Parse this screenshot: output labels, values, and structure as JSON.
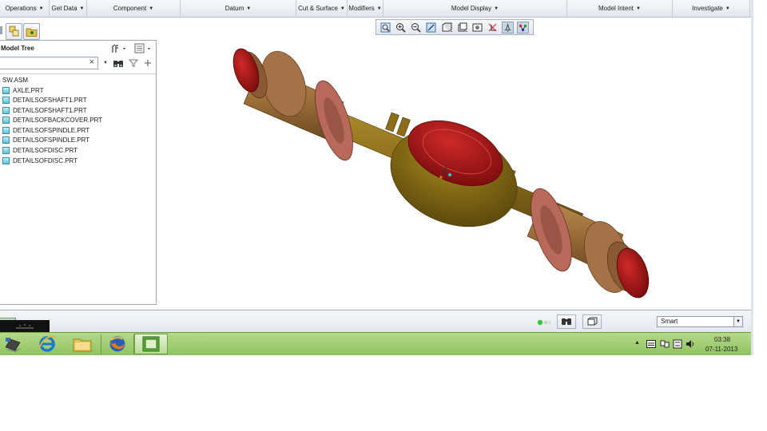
{
  "ribbon": {
    "menus": [
      {
        "label": "Operations"
      },
      {
        "label": "Get Data"
      },
      {
        "label": "Component"
      },
      {
        "label": "Datum"
      },
      {
        "label": "Cut & Surface"
      },
      {
        "label": "Modifiers"
      },
      {
        "label": "Model Display"
      },
      {
        "label": "Model Intent"
      },
      {
        "label": "Investigate"
      }
    ]
  },
  "model_tree": {
    "title": "Model Tree",
    "search_value": "",
    "clear_symbol": "×",
    "root": "SW.ASM",
    "items": [
      {
        "label": "AXLE.PRT"
      },
      {
        "label": "DETAILSOFSHAFT1.PRT"
      },
      {
        "label": "DETAILSOFSHAFT1.PRT"
      },
      {
        "label": "DETAILSOFBACKCOVER.PRT"
      },
      {
        "label": "DETAILSOFSPINDLE.PRT"
      },
      {
        "label": "DETAILSOFSPINDLE.PRT"
      },
      {
        "label": "DETAILSOFDISC.PRT"
      },
      {
        "label": "DETAILSOFDISC.PRT"
      }
    ]
  },
  "viewport_toolbar": {
    "icons": [
      "zoom-fit-icon",
      "zoom-in-icon",
      "zoom-out-icon",
      "repaint-icon",
      "display-style-icon",
      "saved-views-icon",
      "view-manager-icon",
      "datum-display-icon",
      "annotation-display-icon",
      "spin-center-icon"
    ]
  },
  "status_bar": {
    "filter_value": "Smart"
  },
  "taskbar": {
    "time": "03:38",
    "date": "07-11-2013"
  },
  "colors": {
    "axle_body": "#8a6a22",
    "flange": "#b56a5a",
    "hub_red": "#a81818",
    "taskbar": "#9ecb6c"
  }
}
